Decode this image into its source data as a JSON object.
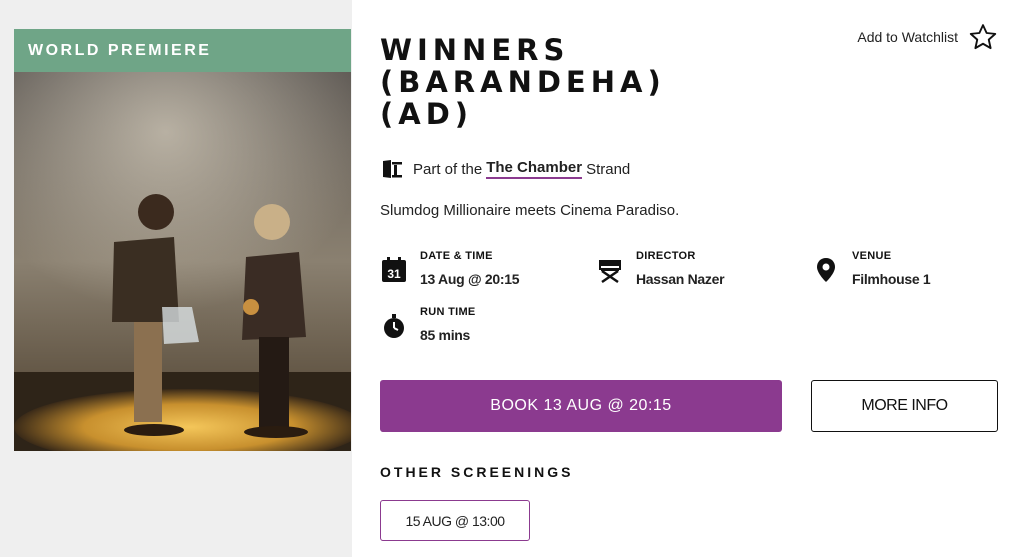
{
  "poster": {
    "badge": "WORLD PREMIERE",
    "image_description_icon": "film-still-image"
  },
  "film": {
    "title_lines": [
      "WINNERS",
      "(BARANDEHA)",
      "(AD)"
    ],
    "tagline": "Slumdog Millionaire meets Cinema Paradiso."
  },
  "watchlist": {
    "label": "Add to Watchlist",
    "icon": "star-outline-icon"
  },
  "strand": {
    "prefix": "Part of the",
    "name": "The Chamber",
    "suffix": "Strand",
    "icon": "film-camera-icon"
  },
  "meta": {
    "datetime": {
      "label": "DATE & TIME",
      "value": "13 Aug @ 20:15",
      "icon": "calendar-icon",
      "icon_text": "31"
    },
    "director": {
      "label": "DIRECTOR",
      "value": "Hassan Nazer",
      "icon": "director-chair-icon"
    },
    "venue": {
      "label": "VENUE",
      "value": "Filmhouse 1",
      "icon": "location-pin-icon"
    },
    "runtime": {
      "label": "RUN TIME",
      "value": "85 mins",
      "icon": "stopwatch-icon"
    }
  },
  "actions": {
    "book_label": "BOOK 13 AUG @ 20:15",
    "more_label": "MORE INFO"
  },
  "other_screenings": {
    "heading": "OTHER SCREENINGS",
    "items": [
      "15 AUG @ 13:00"
    ]
  },
  "colors": {
    "accent": "#8b3a8f",
    "badge": "#6fa587",
    "sidebar_bg": "#efefef"
  }
}
